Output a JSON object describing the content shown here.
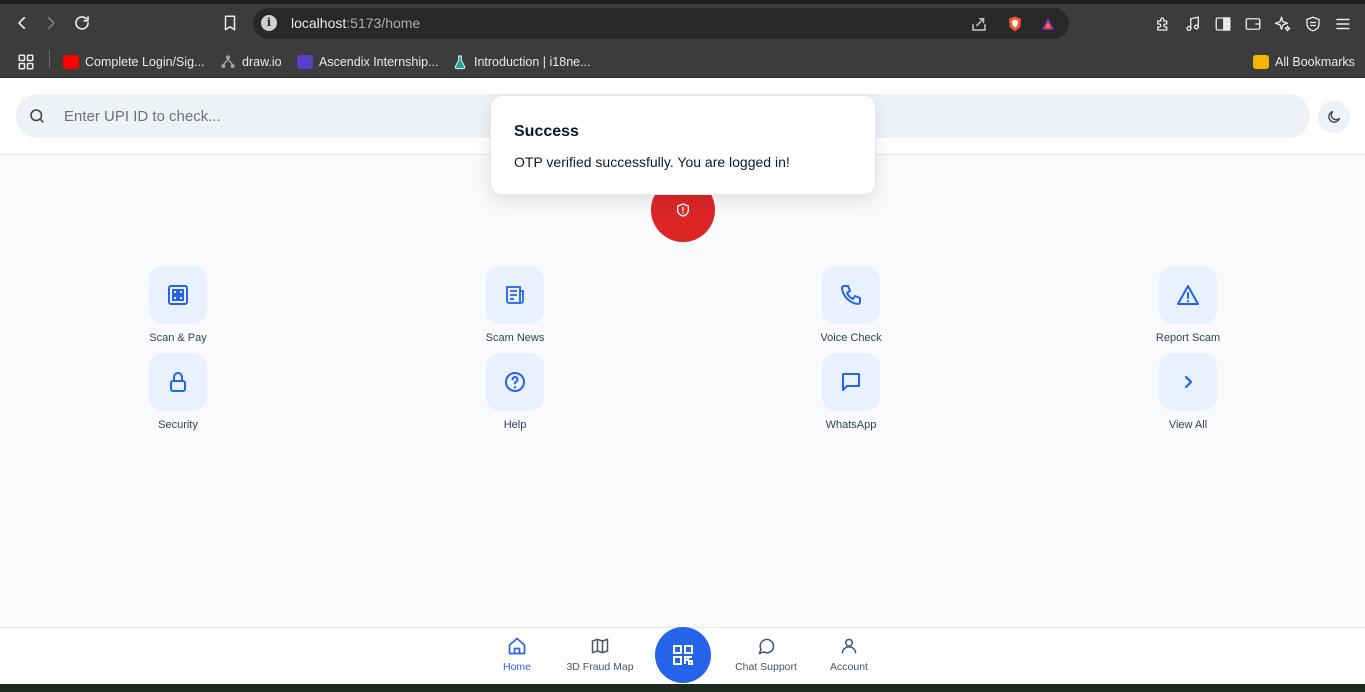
{
  "browser": {
    "url_host": "localhost",
    "url_path": ":5173/home",
    "bookmarks": [
      {
        "label": "Complete Login/Sig...",
        "icon": "youtube-icon"
      },
      {
        "label": "draw.io",
        "icon": "drawio-icon"
      },
      {
        "label": "Ascendix Internship...",
        "icon": "list-icon"
      },
      {
        "label": "Introduction | i18ne...",
        "icon": "flask-icon"
      }
    ],
    "all_bookmarks": "All Bookmarks"
  },
  "search": {
    "placeholder": "Enter UPI ID to check..."
  },
  "toast": {
    "title": "Success",
    "message": "OTP verified successfully. You are logged in!"
  },
  "tiles": [
    {
      "label": "Scan & Pay",
      "icon": "grid-icon"
    },
    {
      "label": "Scam News",
      "icon": "newspaper-icon"
    },
    {
      "label": "Voice Check",
      "icon": "phone-icon"
    },
    {
      "label": "Report Scam",
      "icon": "warning-icon"
    },
    {
      "label": "Security",
      "icon": "lock-icon"
    },
    {
      "label": "Help",
      "icon": "help-icon"
    },
    {
      "label": "WhatsApp",
      "icon": "chat-icon"
    },
    {
      "label": "View All",
      "icon": "chevron-right-icon"
    }
  ],
  "bottom_nav": {
    "items": [
      {
        "label": "Home",
        "icon": "home-icon",
        "active": true
      },
      {
        "label": "3D Fraud Map",
        "icon": "map-icon",
        "active": false
      },
      {
        "label": "Chat Support",
        "icon": "message-circle-icon",
        "active": false
      },
      {
        "label": "Account",
        "icon": "user-icon",
        "active": false
      }
    ],
    "fab_icon": "qr-code-icon"
  },
  "colors": {
    "accent": "#2563eb",
    "danger": "#dc2626",
    "tile_bg": "#e8f1fd"
  }
}
